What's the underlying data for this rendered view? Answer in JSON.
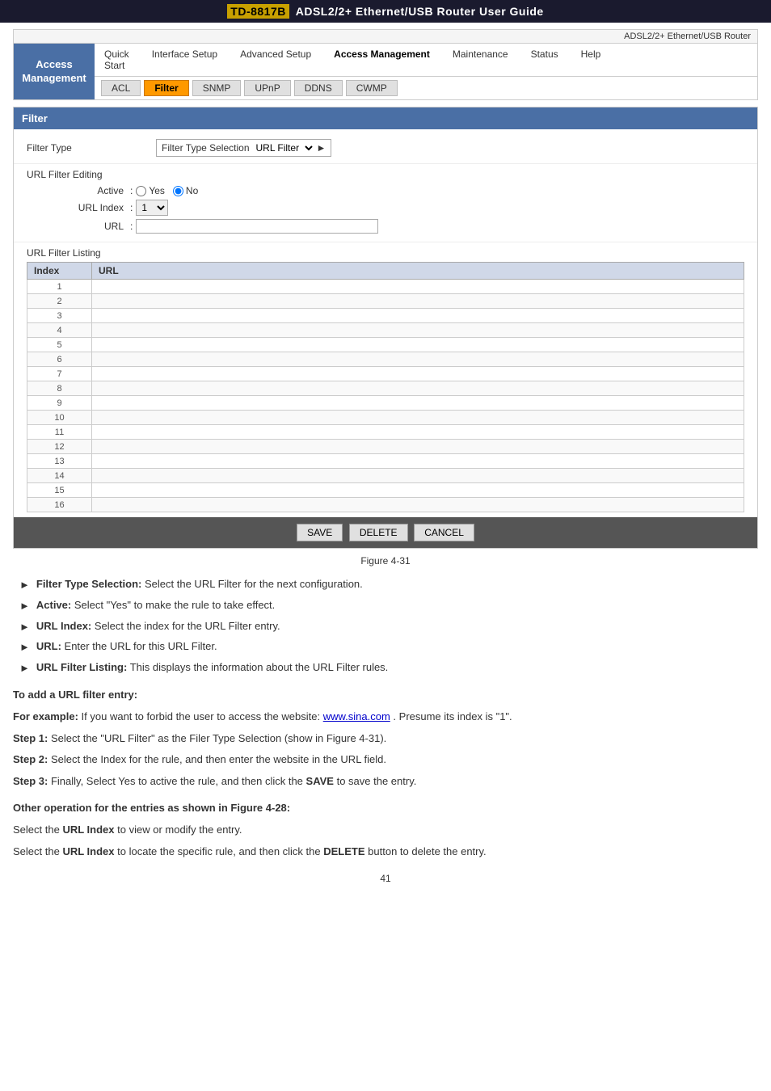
{
  "header": {
    "model": "TD-8817B",
    "title": "ADSL2/2+ Ethernet/USB Router User Guide",
    "adsl_label": "ADSL2/2+ Ethernet/USB Router"
  },
  "nav": {
    "active_section": "Access Management",
    "items": [
      {
        "label": "Quick\nStart",
        "key": "quick-start"
      },
      {
        "label": "Interface Setup",
        "key": "interface-setup"
      },
      {
        "label": "Advanced Setup",
        "key": "advanced-setup"
      },
      {
        "label": "Access Management",
        "key": "access-management",
        "active": true
      },
      {
        "label": "Maintenance",
        "key": "maintenance"
      },
      {
        "label": "Status",
        "key": "status"
      },
      {
        "label": "Help",
        "key": "help"
      }
    ],
    "sub_items": [
      {
        "label": "ACL",
        "key": "acl"
      },
      {
        "label": "Filter",
        "key": "filter",
        "active": true
      },
      {
        "label": "SNMP",
        "key": "snmp"
      },
      {
        "label": "UPnP",
        "key": "upnp"
      },
      {
        "label": "DDNS",
        "key": "ddns"
      },
      {
        "label": "CWMP",
        "key": "cwmp"
      }
    ]
  },
  "filter_section": {
    "title": "Filter",
    "filter_type_label": "Filter Type",
    "filter_type_selector_label": "Filter Type Selection",
    "filter_type_value": "URL Filter",
    "url_filter_editing_label": "URL Filter Editing",
    "active_label": "Active",
    "active_yes": "Yes",
    "active_no": "No",
    "url_index_label": "URL Index",
    "url_index_value": "1",
    "url_label": "URL",
    "url_value": "",
    "url_filter_listing_label": "URL Filter Listing",
    "table_headers": [
      "Index",
      "URL"
    ],
    "table_rows": [
      {
        "index": "1",
        "url": ""
      },
      {
        "index": "2",
        "url": ""
      },
      {
        "index": "3",
        "url": ""
      },
      {
        "index": "4",
        "url": ""
      },
      {
        "index": "5",
        "url": ""
      },
      {
        "index": "6",
        "url": ""
      },
      {
        "index": "7",
        "url": ""
      },
      {
        "index": "8",
        "url": ""
      },
      {
        "index": "9",
        "url": ""
      },
      {
        "index": "10",
        "url": ""
      },
      {
        "index": "11",
        "url": ""
      },
      {
        "index": "12",
        "url": ""
      },
      {
        "index": "13",
        "url": ""
      },
      {
        "index": "14",
        "url": ""
      },
      {
        "index": "15",
        "url": ""
      },
      {
        "index": "16",
        "url": ""
      }
    ],
    "buttons": {
      "save": "SAVE",
      "delete": "DELETE",
      "cancel": "CANCEL"
    }
  },
  "figure_caption": "Figure 4-31",
  "body_bullets": [
    {
      "term": "Filter Type Selection:",
      "text": "Select the URL Filter for the next configuration."
    },
    {
      "term": "Active:",
      "text": "Select \"Yes\" to make the rule to take effect."
    },
    {
      "term": "URL Index:",
      "text": "Select the index for the URL Filter entry."
    },
    {
      "term": "URL:",
      "text": "Enter the URL for this URL Filter."
    },
    {
      "term": "URL Filter Listing:",
      "text": "This displays the information about the URL Filter rules."
    }
  ],
  "add_section": {
    "title": "To add a URL filter entry:",
    "for_example_label": "For example:",
    "for_example_text": "If you want to forbid the user to access the website: www.sina.com. Presume its index is \"1\".",
    "step1_label": "Step 1:",
    "step1_text": "Select the \"URL Filter\" as the Filer Type Selection (show in Figure 4-31).",
    "step2_label": "Step 2:",
    "step2_text": "Select the Index for the rule, and then enter the website in the URL field.",
    "step3_label": "Step 3:",
    "step3_text": "Finally, Select Yes to active the rule, and then click the",
    "step3_save": "SAVE",
    "step3_end": "to save the entry.",
    "link": "www.sina.com"
  },
  "other_section": {
    "title": "Other operation for the entries as shown in Figure 4-28:",
    "para1_start": "Select the",
    "para1_bold": "URL Index",
    "para1_end": "to view or modify the entry.",
    "para2_start": "Select the",
    "para2_bold": "URL Index",
    "para2_mid": "to locate the specific rule, and then click the",
    "para2_delete": "DELETE",
    "para2_end": "button to delete the entry."
  },
  "page_number": "41"
}
